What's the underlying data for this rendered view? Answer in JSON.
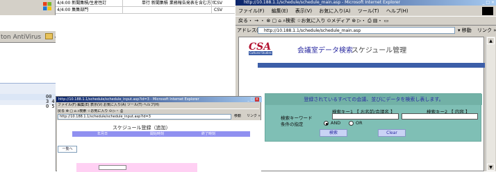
{
  "desktop": {
    "antivirus_label": "ton AntiVirus",
    "left_numbers": [
      "00",
      "3 4",
      "0 5"
    ]
  },
  "background_list": {
    "row1_a": "4/4:00  新聞集積/生産性訂",
    "row1_b": "単行 新聞集積 業務報告発表を含む方で",
    "row1_c": "CSV",
    "row2_a": "4/4:00  集集部門",
    "row2_b": "CSV"
  },
  "ie_main": {
    "title": "http://10.188.1.1/schedule/schedule_main.asp - Microsoft Internet Explorer",
    "menu": [
      "ファイル(F)",
      "編集(E)",
      "表示(V)",
      "お気に入り(A)",
      "ツール(T)",
      "ヘルプ(H)"
    ],
    "toolbar": "戻る・ → ・ ⊗ ▢ ⌂  ⌕検索  ☆お気に入り  ⊙メディア  ⊛  ▷・ ⎙  ▤・ ▭",
    "address_label": "アドレス(D)",
    "address": "http://10.188.1.1/schedule/schedule_main.asp",
    "go": "移動",
    "links": "リンク »",
    "page": {
      "logo": "CSA",
      "logo_sub": "Cultural Studies Assoc.",
      "title": "会議室データ検索",
      "subtitle": "スケジュール管理",
      "panel_heading": "登録されているすべての会議、並びにデータを検索し表します。",
      "key1_label": "検索キー1 【 お名前/会議名 】",
      "key2_label": "検索キー2 【 内容 】",
      "keyword_label": "検索キーワード",
      "condition_label": "条件の指定",
      "radio_and": "AND",
      "radio_or": "OR",
      "search_button": "検索",
      "clear_button": "Clear"
    }
  },
  "ie_small": {
    "title": "http://10.188.1.1/schedule/schedule_input.asp?id=3 - Microsoft Internet Explorer",
    "menu": "ファイル(F)  編集(E)  表示(V)  お気に入り(A)  ツール(T)  ヘルプ(H)",
    "toolbar": "戻る  ⊗ ▢ ⌂  ⌕検索  ☆お気に入り  ⊙  ▷・ ⎙",
    "address": "http://10.188.1.1/schedule/schedule_input.asp?id=3",
    "go": "移動",
    "links": "リンク »",
    "page": {
      "heading": "スケジュール登録（追加）",
      "bar_items": [
        "年月日",
        "開始時刻",
        "終了時刻"
      ],
      "back_button": "一覧へ"
    }
  }
}
